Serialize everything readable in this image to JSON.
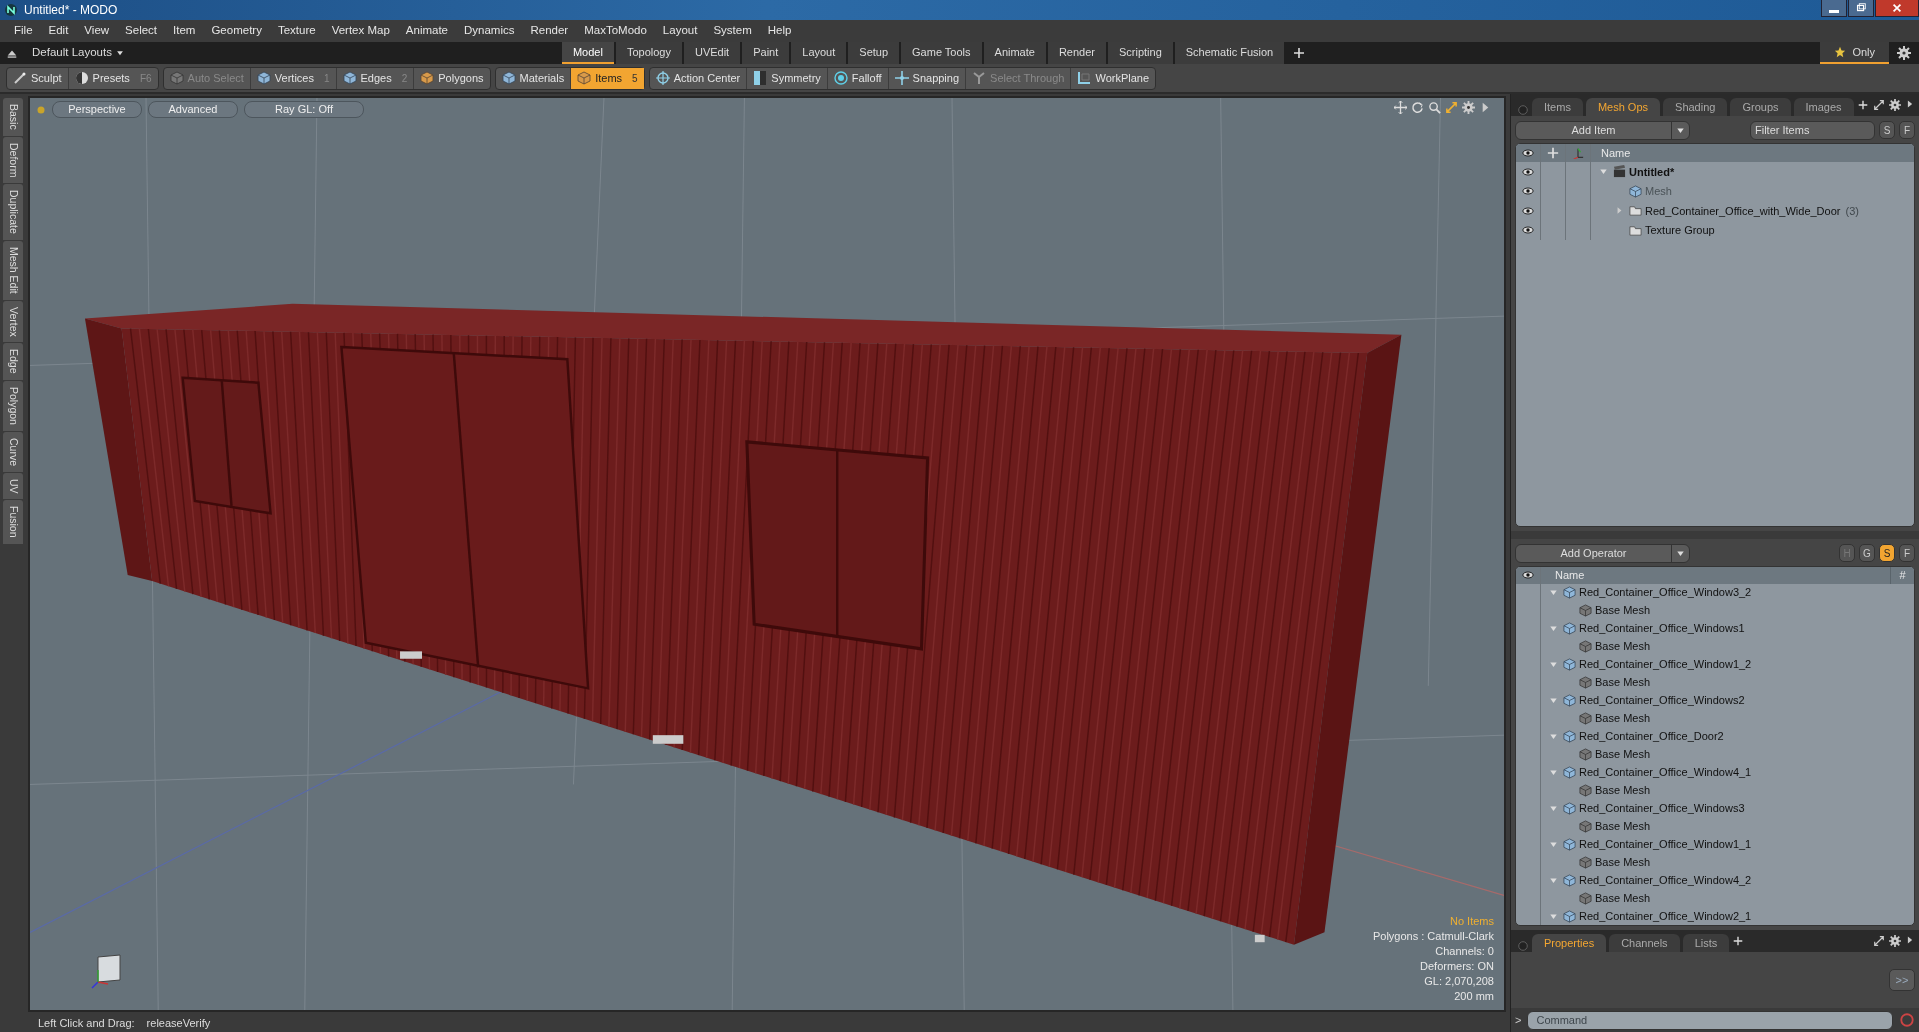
{
  "window": {
    "title": "Untitled* - MODO"
  },
  "menu": [
    "File",
    "Edit",
    "View",
    "Select",
    "Item",
    "Geometry",
    "Texture",
    "Vertex Map",
    "Animate",
    "Dynamics",
    "Render",
    "MaxToModo",
    "Layout",
    "System",
    "Help"
  ],
  "layout_bar": {
    "layouts": "Default Layouts",
    "tabs": [
      {
        "label": "Model",
        "selected": true
      },
      {
        "label": "Topology",
        "selected": false
      },
      {
        "label": "UVEdit",
        "selected": false
      },
      {
        "label": "Paint",
        "selected": false
      },
      {
        "label": "Layout",
        "selected": false
      },
      {
        "label": "Setup",
        "selected": false
      },
      {
        "label": "Game Tools",
        "selected": false
      },
      {
        "label": "Animate",
        "selected": false
      },
      {
        "label": "Render",
        "selected": false
      },
      {
        "label": "Scripting",
        "selected": false
      },
      {
        "label": "Schematic Fusion",
        "selected": false
      }
    ],
    "only": "Only"
  },
  "toolbar": {
    "items": [
      {
        "label": "Sculpt",
        "selected": false,
        "disabled": false
      },
      {
        "label": "Presets",
        "shortcut": "F6",
        "selected": false,
        "disabled": false
      },
      {
        "label": "Auto Select",
        "selected": false,
        "disabled": true
      },
      {
        "label": "Vertices",
        "shortcut": "1",
        "selected": false,
        "disabled": false
      },
      {
        "label": "Edges",
        "shortcut": "2",
        "selected": false,
        "disabled": false
      },
      {
        "label": "Polygons",
        "selected": false,
        "disabled": false
      },
      {
        "label": "Materials",
        "selected": false,
        "disabled": false
      },
      {
        "label": "Items",
        "shortcut": "5",
        "selected": true,
        "disabled": false
      },
      {
        "label": "Action Center",
        "selected": false,
        "disabled": false
      },
      {
        "label": "Symmetry",
        "selected": false,
        "disabled": false
      },
      {
        "label": "Falloff",
        "selected": false,
        "disabled": false
      },
      {
        "label": "Snapping",
        "selected": false,
        "disabled": false
      },
      {
        "label": "Select Through",
        "selected": false,
        "disabled": true
      },
      {
        "label": "WorkPlane",
        "selected": false,
        "disabled": false
      }
    ]
  },
  "side_tabs": [
    "Basic",
    "Deform",
    "Duplicate",
    "Mesh Edit",
    "Vertex",
    "Edge",
    "Polygon",
    "Curve",
    "UV",
    "Fusion"
  ],
  "viewport": {
    "buttons": [
      "Perspective",
      "Advanced",
      "Ray GL: Off"
    ],
    "selection": "No Items",
    "info": [
      "Polygons : Catmull-Clark",
      "Channels: 0",
      "Deformers: ON",
      "GL: 2,070,208",
      "200 mm"
    ]
  },
  "status_bar": {
    "hint": "Left Click and Drag:",
    "action": "releaseVerify"
  },
  "items_panel": {
    "tabs": [
      {
        "label": "Items",
        "selected": false
      },
      {
        "label": "Mesh Ops",
        "selected": true
      },
      {
        "label": "Shading",
        "selected": false
      },
      {
        "label": "Groups",
        "selected": false
      },
      {
        "label": "Images",
        "selected": false
      }
    ],
    "add_button": "Add Item",
    "filter": {
      "placeholder": "Filter Items"
    },
    "toggles": [
      "S",
      "F"
    ],
    "column": "Name",
    "tree": [
      {
        "label": "Untitled*",
        "kind": "scene",
        "visible": true,
        "expanded": true,
        "children": [
          {
            "label": "Mesh",
            "kind": "mesh",
            "visible": true,
            "disabled": true
          },
          {
            "label": "Red_Container_Office_with_Wide_Door",
            "count": "(3)",
            "kind": "group",
            "visible": true,
            "disabled": false,
            "expanded": false
          },
          {
            "label": "Texture Group",
            "kind": "group",
            "visible": true,
            "disabled": false
          }
        ]
      }
    ]
  },
  "meshops_panel": {
    "add_button": "Add Operator",
    "toggles": [
      {
        "label": "H",
        "selected": false,
        "disabled": true
      },
      {
        "label": "G",
        "selected": false,
        "disabled": false
      },
      {
        "label": "S",
        "selected": true,
        "disabled": false
      },
      {
        "label": "F",
        "selected": false,
        "disabled": false
      }
    ],
    "columns": [
      "Name",
      "#"
    ],
    "tree": [
      {
        "label": "Red_Container_Office_Window3_2",
        "kind": "mesh",
        "expanded": true,
        "children": [
          {
            "label": "Base Mesh",
            "kind": "base"
          }
        ]
      },
      {
        "label": "Red_Container_Office_Windows1",
        "kind": "mesh",
        "expanded": true,
        "children": [
          {
            "label": "Base Mesh",
            "kind": "base"
          }
        ]
      },
      {
        "label": "Red_Container_Office_Window1_2",
        "kind": "mesh",
        "expanded": true,
        "children": [
          {
            "label": "Base Mesh",
            "kind": "base"
          }
        ]
      },
      {
        "label": "Red_Container_Office_Windows2",
        "kind": "mesh",
        "expanded": true,
        "children": [
          {
            "label": "Base Mesh",
            "kind": "base"
          }
        ]
      },
      {
        "label": "Red_Container_Office_Door2",
        "kind": "mesh",
        "expanded": true,
        "children": [
          {
            "label": "Base Mesh",
            "kind": "base"
          }
        ]
      },
      {
        "label": "Red_Container_Office_Window4_1",
        "kind": "mesh",
        "expanded": true,
        "children": [
          {
            "label": "Base Mesh",
            "kind": "base"
          }
        ]
      },
      {
        "label": "Red_Container_Office_Windows3",
        "kind": "mesh",
        "expanded": true,
        "children": [
          {
            "label": "Base Mesh",
            "kind": "base"
          }
        ]
      },
      {
        "label": "Red_Container_Office_Window1_1",
        "kind": "mesh",
        "expanded": true,
        "children": [
          {
            "label": "Base Mesh",
            "kind": "base"
          }
        ]
      },
      {
        "label": "Red_Container_Office_Window4_2",
        "kind": "mesh",
        "expanded": true,
        "children": [
          {
            "label": "Base Mesh",
            "kind": "base"
          }
        ]
      },
      {
        "label": "Red_Container_Office_Window2_1",
        "kind": "mesh",
        "expanded": true
      }
    ]
  },
  "properties_panel": {
    "tabs": [
      {
        "label": "Properties",
        "selected": true
      },
      {
        "label": "Channels",
        "selected": false
      },
      {
        "label": "Lists",
        "selected": false
      }
    ],
    "expand_button": ">>"
  },
  "command": {
    "prompt": ">",
    "placeholder": "Command"
  }
}
